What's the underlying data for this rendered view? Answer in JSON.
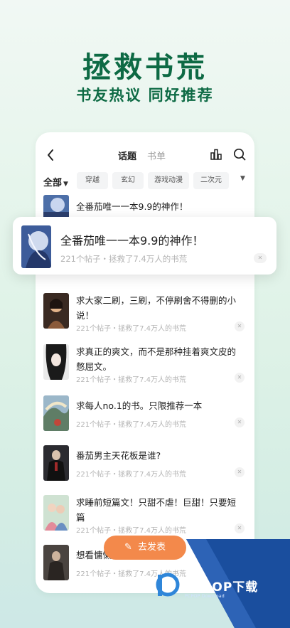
{
  "hero": {
    "title": "拯救书荒",
    "subtitle": "书友热议 同好推荐"
  },
  "header": {
    "tabs": [
      "话题",
      "书单"
    ],
    "active_tab": "话题"
  },
  "icons": {
    "back": "back-arrow-icon",
    "rank": "ranking-icon",
    "search": "search-icon",
    "close": "close-icon",
    "pen": "pen-icon",
    "more": "chevron-down-icon"
  },
  "filter": {
    "selected": "全部",
    "chips": [
      "穿越",
      "玄幻",
      "游戏动漫",
      "二次元"
    ]
  },
  "popup": {
    "title": "全番茄唯一一本9.9的神作！",
    "meta": "221个帖子・拯救了7.4万人的书荒"
  },
  "topics": [
    {
      "title": "全番茄唯一一本9.9的神作！",
      "meta": ""
    },
    {
      "title": "求大家二刷，三刷，不停刷舍不得删的小说！",
      "meta": "221个帖子・拯救了7.4万人的书荒"
    },
    {
      "title": "求真正的爽文，而不是那种挂着爽文皮的憋屈文。",
      "meta": "221个帖子・拯救了7.4万人的书荒"
    },
    {
      "title": "求每人no.1的书。只限推荐一本",
      "meta": "221个帖子・拯救了7.4万人的书荒"
    },
    {
      "title": "番茄男主天花板是谁?",
      "meta": "221个帖子・拯救了7.4万人的书荒"
    },
    {
      "title": "求睡前短篇文！只甜不虐！巨甜！只要短篇",
      "meta": "221个帖子・拯救了7.4万人的书荒"
    },
    {
      "title": "想看慵懒",
      "meta": "221个帖子・拯救了7.4万人的书荒"
    }
  ],
  "post_button": {
    "label": "去发表"
  },
  "watermark": {
    "brand": "PCPOP下载",
    "tagline": "PCPOP Download"
  },
  "colors": {
    "brand_green": "#0d6a44",
    "accent_orange": "#f3894b",
    "watermark_blue": "#1a4e9e"
  }
}
